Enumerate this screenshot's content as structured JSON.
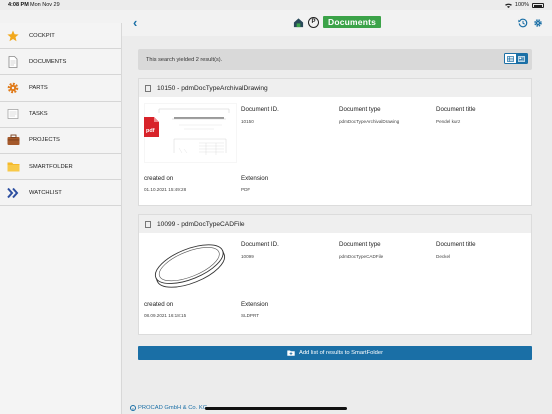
{
  "status_bar": {
    "time": "4:08 PM",
    "date": "Mon Nov 29",
    "battery": "100%"
  },
  "navbar": {
    "title": "Documents",
    "p_badge": "P",
    "accent_color": "#3ca349",
    "link_color": "#1a6fa6"
  },
  "sidebar": {
    "items": [
      {
        "label": "COCKPIT",
        "icon": "star-icon"
      },
      {
        "label": "DOCUMENTS",
        "icon": "document-icon"
      },
      {
        "label": "PARTS",
        "icon": "gear-icon"
      },
      {
        "label": "TASKS",
        "icon": "tasks-icon"
      },
      {
        "label": "PROJECTS",
        "icon": "briefcase-icon"
      },
      {
        "label": "SMARTFOLDER",
        "icon": "folder-icon"
      },
      {
        "label": "WATCHLIST",
        "icon": "double-chevron-icon"
      }
    ]
  },
  "results": {
    "summary": "This search yielded 2 result(s).",
    "cards": [
      {
        "title": "10150 - pdmDocTypeArchivalDrawing",
        "thumbnail": "pdf-drawing-thumbnail",
        "document_id_label": "Document ID.",
        "document_id": "10150",
        "document_type_label": "Document type",
        "document_type": "pdmDocTypeArchivalDrawing",
        "document_title_label": "Document title",
        "document_title": "Pendel kurz",
        "created_label": "created on",
        "created": "01.10.2021 15:49:28",
        "extension_label": "Extension",
        "extension": "PDF",
        "pdf_badge": "pdf"
      },
      {
        "title": "10099 - pdmDocTypeCADFile",
        "thumbnail": "cad-disc-thumbnail",
        "document_id_label": "Document ID.",
        "document_id": "10099",
        "document_type_label": "Document type",
        "document_type": "pdmDocTypeCADFile",
        "document_title_label": "Document title",
        "document_title": "Deckel",
        "created_label": "created on",
        "created": "08.09.2021 16:18:15",
        "extension_label": "Extension",
        "extension": "SLDPRT"
      }
    ]
  },
  "actions": {
    "add_to_smartfolder": "Add list of results to SmartFolder"
  },
  "footer": {
    "copyright": "PROCAD GmbH & Co. KG"
  }
}
